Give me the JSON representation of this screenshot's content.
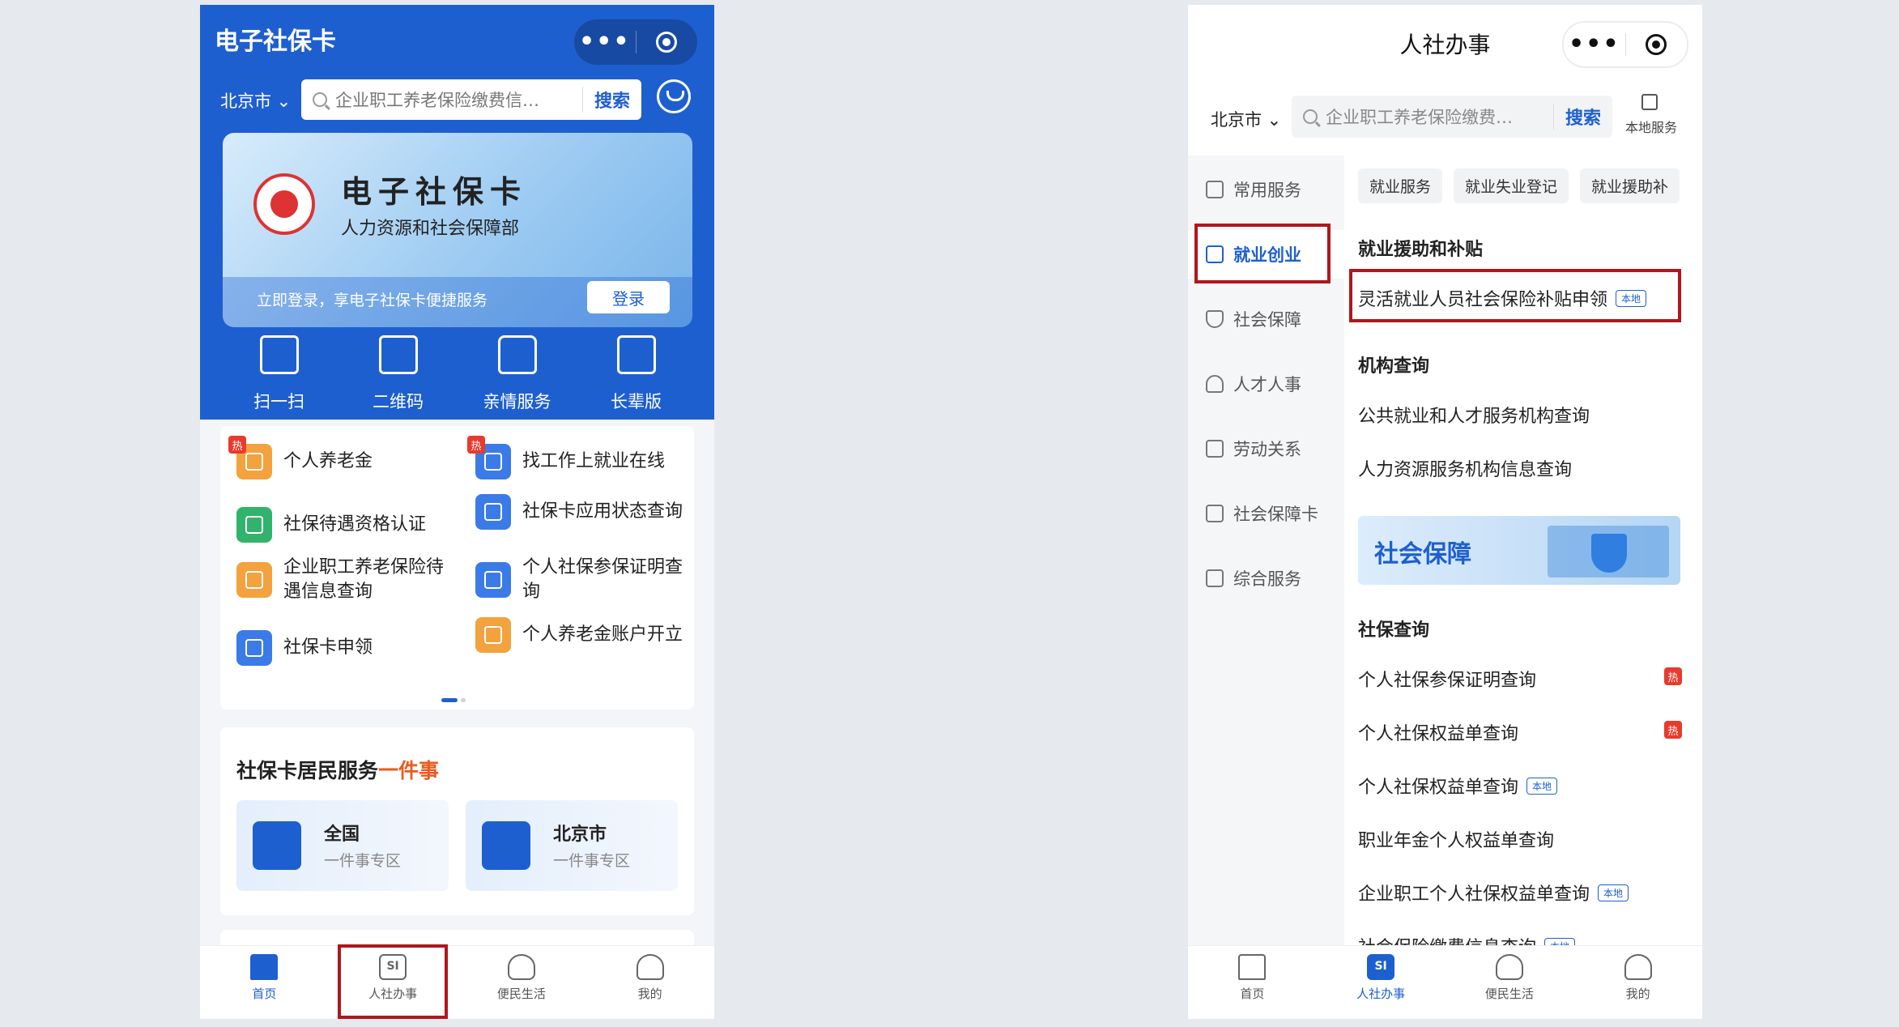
{
  "left": {
    "title": "电子社保卡",
    "city": "北京市",
    "search": {
      "placeholder": "企业职工养老保险缴费信…",
      "button": "搜索"
    },
    "card": {
      "title": "电子社保卡",
      "subtitle": "人力资源和社会保障部",
      "note": "立即登录，享电子社保卡便捷服务",
      "login": "登录"
    },
    "quick": [
      "扫一扫",
      "二维码",
      "亲情服务",
      "长辈版"
    ],
    "services": [
      {
        "label": "个人养老金",
        "hot": "热",
        "color": "#f3a23d"
      },
      {
        "label": "找工作上就业在线",
        "hot": "热",
        "color": "#3b7be8"
      },
      {
        "label": "社保待遇资格认证",
        "hot": "",
        "color": "#32b36b"
      },
      {
        "label": "社保卡应用状态查询",
        "hot": "",
        "color": "#3b7be8"
      },
      {
        "label": "企业职工养老保险待遇信息查询",
        "hot": "",
        "color": "#f3a23d"
      },
      {
        "label": "个人社保参保证明查询",
        "hot": "",
        "color": "#3b7be8"
      },
      {
        "label": "社保卡申领",
        "hot": "",
        "color": "#3b7be8"
      },
      {
        "label": "个人养老金账户开立",
        "hot": "",
        "color": "#f3a23d"
      }
    ],
    "onething": {
      "title_a": "社保卡居民服务",
      "title_b": "一件事",
      "zones": [
        {
          "name": "全国",
          "sub": "一件事专区"
        },
        {
          "name": "北京市",
          "sub": "一件事专区"
        }
      ]
    },
    "tabs": [
      "首页",
      "人社办事",
      "便民生活",
      "我的"
    ],
    "tab_si": "SI"
  },
  "right": {
    "title": "人社办事",
    "city": "北京市",
    "search": {
      "placeholder": "企业职工养老保险缴费…",
      "button": "搜索"
    },
    "local_service": "本地服务",
    "sidebar": [
      "常用服务",
      "就业创业",
      "社会保障",
      "人才人事",
      "劳动关系",
      "社会保障卡",
      "综合服务"
    ],
    "chips": [
      "就业服务",
      "就业失业登记",
      "就业援助补"
    ],
    "sections": {
      "assist": {
        "title": "就业援助和补贴",
        "items": [
          {
            "label": "灵活就业人员社会保险补贴申领",
            "tag": "本地"
          }
        ]
      },
      "org": {
        "title": "机构查询",
        "items": [
          "公共就业和人才服务机构查询",
          "人力资源服务机构信息查询"
        ]
      },
      "banner": "社会保障",
      "query": {
        "title": "社保查询",
        "items": [
          {
            "label": "个人社保参保证明查询",
            "tag": "",
            "hot": "热"
          },
          {
            "label": "个人社保权益单查询",
            "tag": "",
            "hot": "热"
          },
          {
            "label": "个人社保权益单查询",
            "tag": "本地",
            "hot": ""
          },
          {
            "label": "职业年金个人权益单查询",
            "tag": "",
            "hot": ""
          },
          {
            "label": "企业职工个人社保权益单查询",
            "tag": "本地",
            "hot": ""
          },
          {
            "label": "社会保险缴费信息查询",
            "tag": "本地",
            "hot": ""
          }
        ]
      }
    },
    "tabs": [
      "首页",
      "人社办事",
      "便民生活",
      "我的"
    ],
    "tab_si": "SI"
  },
  "colors": {
    "brand_blue": "#1e5fd0",
    "hot_red": "#e83a2d",
    "highlight_red": "#b0161d",
    "accent_orange": "#ea5a1e"
  }
}
